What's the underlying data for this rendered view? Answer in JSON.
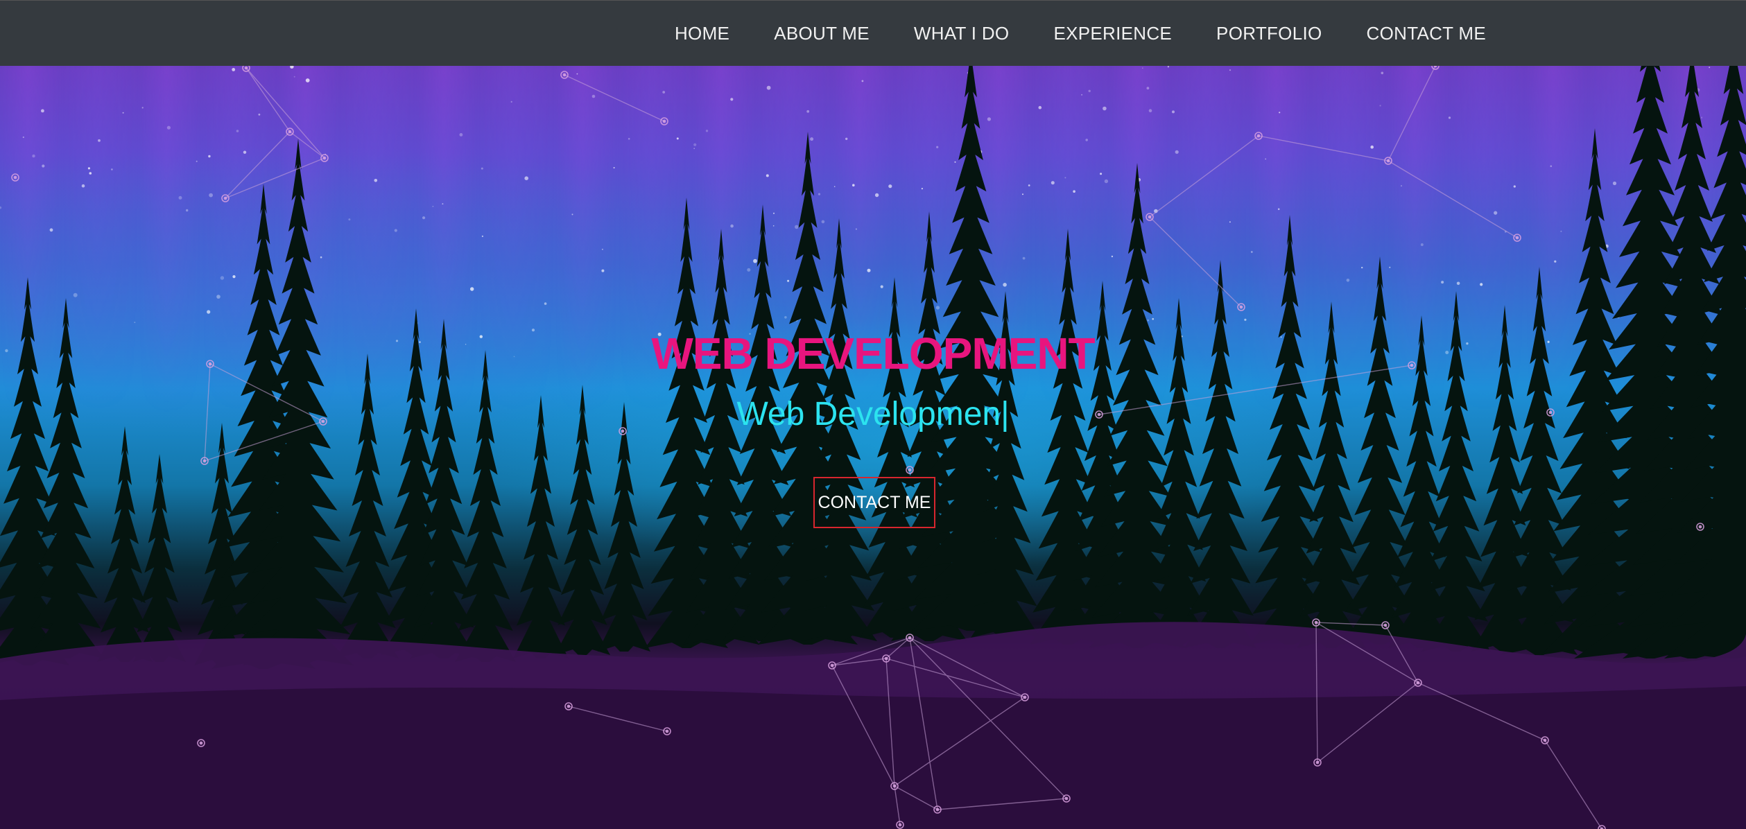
{
  "nav": {
    "items": [
      {
        "label": "HOME"
      },
      {
        "label": "ABOUT ME"
      },
      {
        "label": "WHAT I DO"
      },
      {
        "label": "EXPERIENCE"
      },
      {
        "label": "PORTFOLIO"
      },
      {
        "label": "CONTACT ME"
      }
    ]
  },
  "hero": {
    "title": "WEB DEVELOPMENT",
    "typed_text": "Web Developmen",
    "cursor": "|",
    "cta_label": "CONTACT ME"
  },
  "colors": {
    "navbar_bg": "#353a3f",
    "title": "#e8157e",
    "subtitle": "#2ce3ef",
    "cta_border": "#d8262e"
  }
}
